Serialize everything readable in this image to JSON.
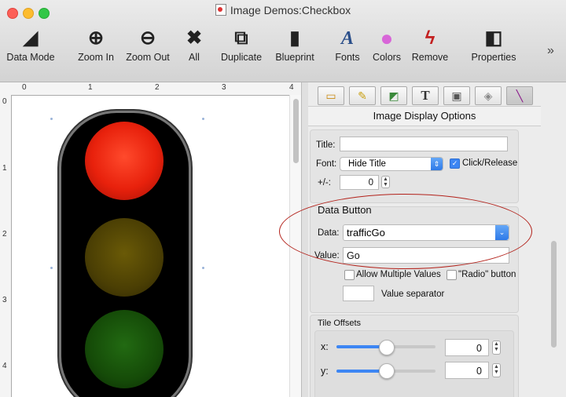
{
  "window": {
    "title": "Image Demos:Checkbox"
  },
  "toolbar": {
    "items": [
      {
        "label": "Data Mode",
        "icon": "data-mode-icon",
        "glyph": "◢"
      },
      {
        "label": "Zoom In",
        "icon": "zoom-in-icon",
        "glyph": "⊕"
      },
      {
        "label": "Zoom Out",
        "icon": "zoom-out-icon",
        "glyph": "⊖"
      },
      {
        "label": "All",
        "icon": "expand-all-icon",
        "glyph": "✖"
      },
      {
        "label": "Duplicate",
        "icon": "duplicate-icon",
        "glyph": "⧉"
      },
      {
        "label": "Blueprint",
        "icon": "blueprint-icon",
        "glyph": "▮"
      },
      {
        "label": "Fonts",
        "icon": "fonts-icon",
        "glyph": "A"
      },
      {
        "label": "Colors",
        "icon": "colors-icon",
        "glyph": "●"
      },
      {
        "label": "Remove",
        "icon": "remove-icon",
        "glyph": "ϟ"
      },
      {
        "label": "Properties",
        "icon": "properties-icon",
        "glyph": "◧"
      }
    ],
    "overflow": "»"
  },
  "ruler": {
    "h": [
      "0",
      "1",
      "2",
      "3",
      "4"
    ],
    "v": [
      "0",
      "1",
      "2",
      "3",
      "4"
    ]
  },
  "palette": {
    "tabs": [
      {
        "name": "image-tab-icon",
        "glyph": "▭"
      },
      {
        "name": "pencil-tab-icon",
        "glyph": "✎"
      },
      {
        "name": "shapes-tab-icon",
        "glyph": "◩"
      },
      {
        "name": "text-tab-icon",
        "glyph": "T"
      },
      {
        "name": "picture-tab-icon",
        "glyph": "▣"
      },
      {
        "name": "eraser-tab-icon",
        "glyph": "◈"
      },
      {
        "name": "line-tab-icon",
        "glyph": "╲"
      }
    ],
    "title": "Image Display Options"
  },
  "display": {
    "title_label": "Title:",
    "title_value": "",
    "font_label": "Font:",
    "font_value": "Hide Title",
    "click_release_label": "Click/Release",
    "plusminus_label": "+/-:",
    "plusminus_value": "0"
  },
  "data_button": {
    "header": "Data Button",
    "data_label": "Data:",
    "data_value": "trafficGo",
    "value_label": "Value:",
    "value_value": "Go",
    "allow_multiple_label": "Allow Multiple Values",
    "radio_label": "\"Radio\" button",
    "separator_label": "Value separator",
    "separator_value": ""
  },
  "tile_offsets": {
    "header": "Tile Offsets",
    "x_label": "x:",
    "x_value": "0",
    "y_label": "y:",
    "y_value": "0",
    "x_slider": 0.5,
    "y_slider": 0.5
  },
  "colors": {
    "annotation": "#b3221b",
    "accent": "#3d86f3"
  }
}
